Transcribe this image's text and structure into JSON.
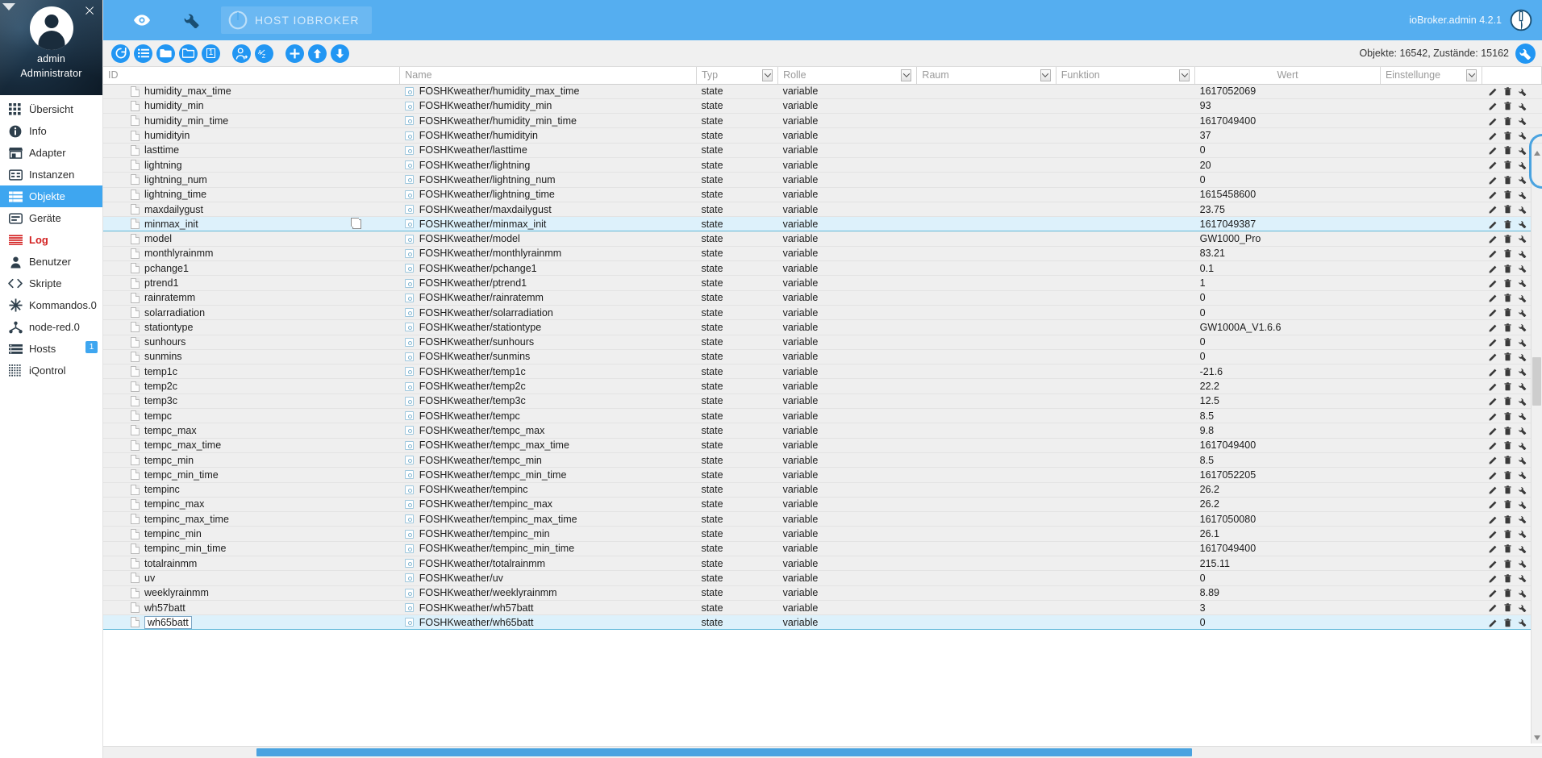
{
  "sidebar": {
    "collapse_arrow": "collapse-arrow",
    "close": "×",
    "profile": {
      "name": "admin",
      "role": "Administrator"
    },
    "items": [
      {
        "label": "Übersicht",
        "icon": "grid-icon",
        "active": false,
        "badge": null
      },
      {
        "label": "Info",
        "icon": "info-icon",
        "active": false,
        "badge": null
      },
      {
        "label": "Adapter",
        "icon": "store-icon",
        "active": false,
        "badge": null
      },
      {
        "label": "Instanzen",
        "icon": "instances-icon",
        "active": false,
        "badge": null
      },
      {
        "label": "Objekte",
        "icon": "list-icon",
        "active": true,
        "badge": null
      },
      {
        "label": "Geräte",
        "icon": "device-icon",
        "active": false,
        "badge": null
      },
      {
        "label": "Log",
        "icon": "log-icon",
        "active": false,
        "badge": null
      },
      {
        "label": "Benutzer",
        "icon": "user-icon",
        "active": false,
        "badge": null
      },
      {
        "label": "Skripte",
        "icon": "code-icon",
        "active": false,
        "badge": null
      },
      {
        "label": "Kommandos.0",
        "icon": "asterisk-icon",
        "active": false,
        "badge": null
      },
      {
        "label": "node-red.0",
        "icon": "nodered-icon",
        "active": false,
        "badge": null
      },
      {
        "label": "Hosts",
        "icon": "hosts-icon",
        "active": false,
        "badge": "1"
      },
      {
        "label": "iQontrol",
        "icon": "dots-grid-icon",
        "active": false,
        "badge": null
      }
    ]
  },
  "topbar": {
    "eye_icon": "eye-icon",
    "wrench_icon": "wrench-icon",
    "host_label": "HOST IOBROKER",
    "power_icon": "power-icon",
    "version": "ioBroker.admin 4.2.1",
    "logout_icon": "power-logout-icon",
    "accent_color": "#55aef0"
  },
  "toolbar": {
    "buttons": [
      {
        "name": "refresh-button",
        "icon": "refresh-icon"
      },
      {
        "name": "expand-all-button",
        "icon": "list-expand-icon"
      },
      {
        "name": "collapse-folder-button",
        "icon": "folder-filled-icon"
      },
      {
        "name": "expand-folder-button",
        "icon": "folder-open-icon"
      },
      {
        "name": "depth-1-button",
        "icon": "number-1-icon",
        "text": "1"
      },
      {
        "name": "expert-mode-button",
        "icon": "expert-icon"
      },
      {
        "name": "sort-az-button",
        "icon": "sort-az-icon"
      },
      {
        "name": "add-object-button",
        "icon": "plus-icon"
      },
      {
        "name": "import-button",
        "icon": "upload-icon"
      },
      {
        "name": "export-button",
        "icon": "download-icon"
      }
    ],
    "counts": "Objekte: 16542, Zustände: 15162",
    "settings_icon": "wrench-icon"
  },
  "table": {
    "columns": [
      {
        "key": "id",
        "label": "ID",
        "filter": false
      },
      {
        "key": "name",
        "label": "Name",
        "filter": false
      },
      {
        "key": "typ",
        "label": "Typ",
        "filter": true
      },
      {
        "key": "rolle",
        "label": "Rolle",
        "filter": true
      },
      {
        "key": "raum",
        "label": "Raum",
        "filter": true
      },
      {
        "key": "funktion",
        "label": "Funktion",
        "filter": true
      },
      {
        "key": "wert",
        "label": "Wert",
        "filter": false
      },
      {
        "key": "settings",
        "label": "Einstellunge",
        "filter": true
      }
    ],
    "rows": [
      {
        "id": "humidity_max_time",
        "name": "FOSHKweather/humidity_max_time",
        "typ": "state",
        "rolle": "variable",
        "raum": "",
        "funktion": "",
        "wert": "1617052069",
        "selected": false,
        "editing": false,
        "copy": false
      },
      {
        "id": "humidity_min",
        "name": "FOSHKweather/humidity_min",
        "typ": "state",
        "rolle": "variable",
        "raum": "",
        "funktion": "",
        "wert": "93",
        "selected": false,
        "editing": false,
        "copy": false
      },
      {
        "id": "humidity_min_time",
        "name": "FOSHKweather/humidity_min_time",
        "typ": "state",
        "rolle": "variable",
        "raum": "",
        "funktion": "",
        "wert": "1617049400",
        "selected": false,
        "editing": false,
        "copy": false
      },
      {
        "id": "humidityin",
        "name": "FOSHKweather/humidityin",
        "typ": "state",
        "rolle": "variable",
        "raum": "",
        "funktion": "",
        "wert": "37",
        "selected": false,
        "editing": false,
        "copy": false
      },
      {
        "id": "lasttime",
        "name": "FOSHKweather/lasttime",
        "typ": "state",
        "rolle": "variable",
        "raum": "",
        "funktion": "",
        "wert": "0",
        "selected": false,
        "editing": false,
        "copy": false
      },
      {
        "id": "lightning",
        "name": "FOSHKweather/lightning",
        "typ": "state",
        "rolle": "variable",
        "raum": "",
        "funktion": "",
        "wert": "20",
        "selected": false,
        "editing": false,
        "copy": false
      },
      {
        "id": "lightning_num",
        "name": "FOSHKweather/lightning_num",
        "typ": "state",
        "rolle": "variable",
        "raum": "",
        "funktion": "",
        "wert": "0",
        "selected": false,
        "editing": false,
        "copy": false
      },
      {
        "id": "lightning_time",
        "name": "FOSHKweather/lightning_time",
        "typ": "state",
        "rolle": "variable",
        "raum": "",
        "funktion": "",
        "wert": "1615458600",
        "selected": false,
        "editing": false,
        "copy": false
      },
      {
        "id": "maxdailygust",
        "name": "FOSHKweather/maxdailygust",
        "typ": "state",
        "rolle": "variable",
        "raum": "",
        "funktion": "",
        "wert": "23.75",
        "selected": false,
        "editing": false,
        "copy": false
      },
      {
        "id": "minmax_init",
        "name": "FOSHKweather/minmax_init",
        "typ": "state",
        "rolle": "variable",
        "raum": "",
        "funktion": "",
        "wert": "1617049387",
        "selected": true,
        "editing": false,
        "copy": true
      },
      {
        "id": "model",
        "name": "FOSHKweather/model",
        "typ": "state",
        "rolle": "variable",
        "raum": "",
        "funktion": "",
        "wert": "GW1000_Pro",
        "selected": false,
        "editing": false,
        "copy": false
      },
      {
        "id": "monthlyrainmm",
        "name": "FOSHKweather/monthlyrainmm",
        "typ": "state",
        "rolle": "variable",
        "raum": "",
        "funktion": "",
        "wert": "83.21",
        "selected": false,
        "editing": false,
        "copy": false
      },
      {
        "id": "pchange1",
        "name": "FOSHKweather/pchange1",
        "typ": "state",
        "rolle": "variable",
        "raum": "",
        "funktion": "",
        "wert": "0.1",
        "selected": false,
        "editing": false,
        "copy": false
      },
      {
        "id": "ptrend1",
        "name": "FOSHKweather/ptrend1",
        "typ": "state",
        "rolle": "variable",
        "raum": "",
        "funktion": "",
        "wert": "1",
        "selected": false,
        "editing": false,
        "copy": false
      },
      {
        "id": "rainratemm",
        "name": "FOSHKweather/rainratemm",
        "typ": "state",
        "rolle": "variable",
        "raum": "",
        "funktion": "",
        "wert": "0",
        "selected": false,
        "editing": false,
        "copy": false
      },
      {
        "id": "solarradiation",
        "name": "FOSHKweather/solarradiation",
        "typ": "state",
        "rolle": "variable",
        "raum": "",
        "funktion": "",
        "wert": "0",
        "selected": false,
        "editing": false,
        "copy": false
      },
      {
        "id": "stationtype",
        "name": "FOSHKweather/stationtype",
        "typ": "state",
        "rolle": "variable",
        "raum": "",
        "funktion": "",
        "wert": "GW1000A_V1.6.6",
        "selected": false,
        "editing": false,
        "copy": false
      },
      {
        "id": "sunhours",
        "name": "FOSHKweather/sunhours",
        "typ": "state",
        "rolle": "variable",
        "raum": "",
        "funktion": "",
        "wert": "0",
        "selected": false,
        "editing": false,
        "copy": false
      },
      {
        "id": "sunmins",
        "name": "FOSHKweather/sunmins",
        "typ": "state",
        "rolle": "variable",
        "raum": "",
        "funktion": "",
        "wert": "0",
        "selected": false,
        "editing": false,
        "copy": false
      },
      {
        "id": "temp1c",
        "name": "FOSHKweather/temp1c",
        "typ": "state",
        "rolle": "variable",
        "raum": "",
        "funktion": "",
        "wert": "-21.6",
        "selected": false,
        "editing": false,
        "copy": false
      },
      {
        "id": "temp2c",
        "name": "FOSHKweather/temp2c",
        "typ": "state",
        "rolle": "variable",
        "raum": "",
        "funktion": "",
        "wert": "22.2",
        "selected": false,
        "editing": false,
        "copy": false
      },
      {
        "id": "temp3c",
        "name": "FOSHKweather/temp3c",
        "typ": "state",
        "rolle": "variable",
        "raum": "",
        "funktion": "",
        "wert": "12.5",
        "selected": false,
        "editing": false,
        "copy": false
      },
      {
        "id": "tempc",
        "name": "FOSHKweather/tempc",
        "typ": "state",
        "rolle": "variable",
        "raum": "",
        "funktion": "",
        "wert": "8.5",
        "selected": false,
        "editing": false,
        "copy": false
      },
      {
        "id": "tempc_max",
        "name": "FOSHKweather/tempc_max",
        "typ": "state",
        "rolle": "variable",
        "raum": "",
        "funktion": "",
        "wert": "9.8",
        "selected": false,
        "editing": false,
        "copy": false
      },
      {
        "id": "tempc_max_time",
        "name": "FOSHKweather/tempc_max_time",
        "typ": "state",
        "rolle": "variable",
        "raum": "",
        "funktion": "",
        "wert": "1617049400",
        "selected": false,
        "editing": false,
        "copy": false
      },
      {
        "id": "tempc_min",
        "name": "FOSHKweather/tempc_min",
        "typ": "state",
        "rolle": "variable",
        "raum": "",
        "funktion": "",
        "wert": "8.5",
        "selected": false,
        "editing": false,
        "copy": false
      },
      {
        "id": "tempc_min_time",
        "name": "FOSHKweather/tempc_min_time",
        "typ": "state",
        "rolle": "variable",
        "raum": "",
        "funktion": "",
        "wert": "1617052205",
        "selected": false,
        "editing": false,
        "copy": false
      },
      {
        "id": "tempinc",
        "name": "FOSHKweather/tempinc",
        "typ": "state",
        "rolle": "variable",
        "raum": "",
        "funktion": "",
        "wert": "26.2",
        "selected": false,
        "editing": false,
        "copy": false
      },
      {
        "id": "tempinc_max",
        "name": "FOSHKweather/tempinc_max",
        "typ": "state",
        "rolle": "variable",
        "raum": "",
        "funktion": "",
        "wert": "26.2",
        "selected": false,
        "editing": false,
        "copy": false
      },
      {
        "id": "tempinc_max_time",
        "name": "FOSHKweather/tempinc_max_time",
        "typ": "state",
        "rolle": "variable",
        "raum": "",
        "funktion": "",
        "wert": "1617050080",
        "selected": false,
        "editing": false,
        "copy": false
      },
      {
        "id": "tempinc_min",
        "name": "FOSHKweather/tempinc_min",
        "typ": "state",
        "rolle": "variable",
        "raum": "",
        "funktion": "",
        "wert": "26.1",
        "selected": false,
        "editing": false,
        "copy": false
      },
      {
        "id": "tempinc_min_time",
        "name": "FOSHKweather/tempinc_min_time",
        "typ": "state",
        "rolle": "variable",
        "raum": "",
        "funktion": "",
        "wert": "1617049400",
        "selected": false,
        "editing": false,
        "copy": false
      },
      {
        "id": "totalrainmm",
        "name": "FOSHKweather/totalrainmm",
        "typ": "state",
        "rolle": "variable",
        "raum": "",
        "funktion": "",
        "wert": "215.11",
        "selected": false,
        "editing": false,
        "copy": false
      },
      {
        "id": "uv",
        "name": "FOSHKweather/uv",
        "typ": "state",
        "rolle": "variable",
        "raum": "",
        "funktion": "",
        "wert": "0",
        "selected": false,
        "editing": false,
        "copy": false
      },
      {
        "id": "weeklyrainmm",
        "name": "FOSHKweather/weeklyrainmm",
        "typ": "state",
        "rolle": "variable",
        "raum": "",
        "funktion": "",
        "wert": "8.89",
        "selected": false,
        "editing": false,
        "copy": false
      },
      {
        "id": "wh57batt",
        "name": "FOSHKweather/wh57batt",
        "typ": "state",
        "rolle": "variable",
        "raum": "",
        "funktion": "",
        "wert": "3",
        "selected": false,
        "editing": false,
        "copy": false
      },
      {
        "id": "wh65batt",
        "name": "FOSHKweather/wh65batt",
        "typ": "state",
        "rolle": "variable",
        "raum": "",
        "funktion": "",
        "wert": "0",
        "selected": true,
        "editing": true,
        "copy": false
      }
    ]
  }
}
